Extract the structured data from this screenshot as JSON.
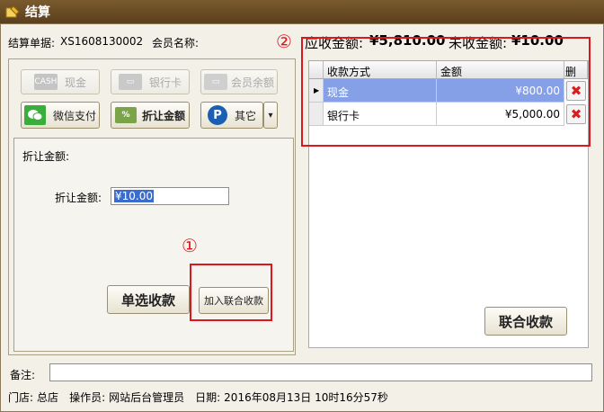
{
  "window": {
    "title": "结算"
  },
  "header": {
    "order_label": "结算单据:",
    "order_value": "XS1608130002",
    "member_label": "会员名称:",
    "member_value": "",
    "receivable_label": "应收金额:",
    "receivable_value": "¥5,810.00",
    "unpaid_label": "未收金额:",
    "unpaid_value": "¥10.00"
  },
  "payment_buttons": {
    "cash": "现金",
    "bank_card": "银行卡",
    "member_balance": "会员余额",
    "wechat": "微信支付",
    "discount": "折让金额",
    "other": "其它"
  },
  "discount_panel": {
    "title": "折让金额:",
    "field_label": "折让金额:",
    "field_value": "¥10.00",
    "single_pay_button": "单选收款",
    "add_combined_button": "加入联合收款"
  },
  "grid": {
    "columns": [
      "收款方式",
      "金额",
      "删除"
    ],
    "rows": [
      {
        "method": "现金",
        "amount": "¥800.00"
      },
      {
        "method": "银行卡",
        "amount": "¥5,000.00"
      }
    ]
  },
  "combined_pay_button": "联合收款",
  "remark": {
    "label": "备注:",
    "value": ""
  },
  "footer": {
    "store_label": "门店:",
    "store_value": "总店",
    "operator_label": "操作员:",
    "operator_value": "网站后台管理员",
    "date_label": "日期:",
    "date_value": "2016年08月13日 10时16分57秒"
  },
  "annotations": {
    "marker1": "①",
    "marker2": "②"
  },
  "colors": {
    "title_bar": "#6b4c24",
    "selected_row": "#86a0e8",
    "annotation_red": "#e0161e",
    "wechat_green": "#3aae3a",
    "paypal_blue": "#1a5fb4"
  }
}
